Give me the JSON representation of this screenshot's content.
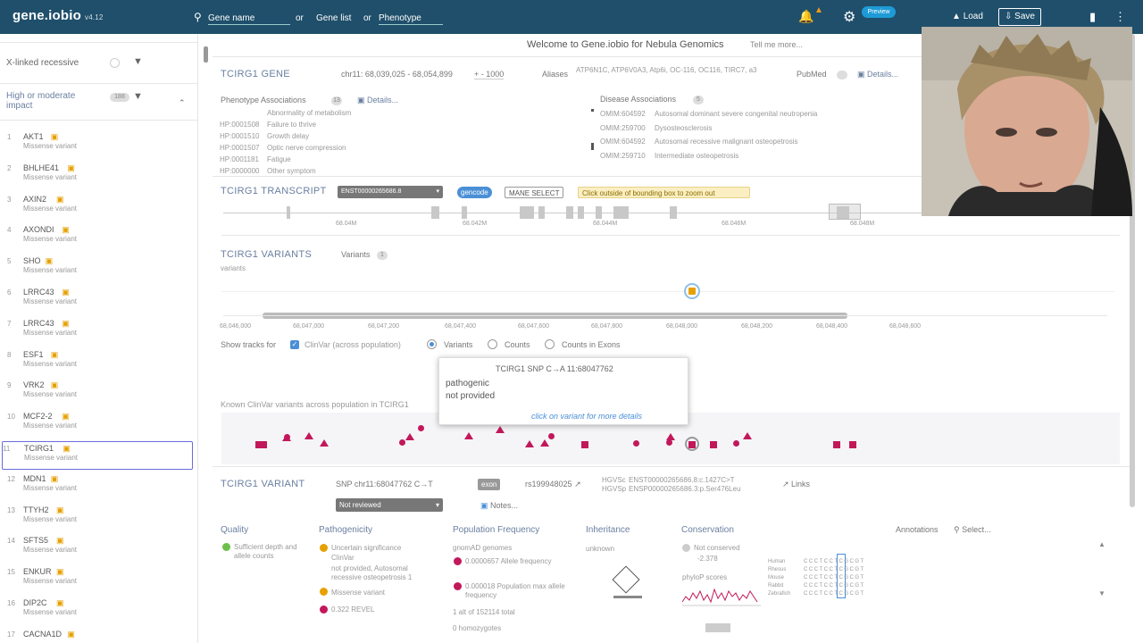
{
  "topbar": {
    "logo": "gene.iobio",
    "version": "v4.12",
    "search": {
      "gene_name": "Gene name",
      "or1": "or",
      "gene_list": "Gene list",
      "or2": "or",
      "phenotype": "Phenotype"
    },
    "pill": "Preview",
    "load": "Load",
    "save": "Save"
  },
  "sidebar": {
    "filter1": "X-linked recessive",
    "filter2_line1": "High or moderate",
    "filter2_line2": "impact",
    "filter2_count": "188",
    "genes": [
      {
        "num": "1",
        "name": "AKT1",
        "type": "Missense variant"
      },
      {
        "num": "2",
        "name": "BHLHE41",
        "type": "Missense variant"
      },
      {
        "num": "3",
        "name": "AXIN2",
        "type": "Missense variant"
      },
      {
        "num": "4",
        "name": "AXONDI",
        "type": "Missense variant"
      },
      {
        "num": "5",
        "name": "SHO",
        "type": "Missense variant"
      },
      {
        "num": "6",
        "name": "LRRC43",
        "type": "Missense variant"
      },
      {
        "num": "7",
        "name": "LRRC43",
        "type": "Missense variant"
      },
      {
        "num": "8",
        "name": "ESF1",
        "type": "Missense variant"
      },
      {
        "num": "9",
        "name": "VRK2",
        "type": "Missense variant"
      },
      {
        "num": "10",
        "name": "MCF2-2",
        "type": "Missense variant"
      },
      {
        "num": "11",
        "name": "TCIRG1",
        "type": "Missense variant"
      },
      {
        "num": "12",
        "name": "MDN1",
        "type": "Missense variant"
      },
      {
        "num": "13",
        "name": "TTYH2",
        "type": "Missense variant"
      },
      {
        "num": "14",
        "name": "SFTS5",
        "type": "Missense variant"
      },
      {
        "num": "15",
        "name": "ENKUR",
        "type": "Missense variant"
      },
      {
        "num": "16",
        "name": "DIP2C",
        "type": "Missense variant"
      },
      {
        "num": "17",
        "name": "CACNA1D",
        "type": ""
      }
    ]
  },
  "welcome": "Welcome to Gene.iobio for Nebula Genomics",
  "tellme": "Tell me more...",
  "gene": {
    "title": "TCIRG1 GENE",
    "coords": "chr11: 68,039,025 - 68,054,899",
    "plusminus": "+ - 1000",
    "aliases_label": "Aliases",
    "aliases": "ATP6N1C, ATP6V0A3, Atp6i, OC-116, OC116, TIRC7, a3",
    "pubmed": "PubMed",
    "details": "Details...",
    "pheno_label": "Phenotype Associations",
    "pheno_count": "13",
    "pheno_details": "Details...",
    "phenotypes": [
      {
        "id": "",
        "name": "Abnormality of metabolism"
      },
      {
        "id": "HP:0001508",
        "name": "Failure to thrive"
      },
      {
        "id": "HP:0001510",
        "name": "Growth delay"
      },
      {
        "id": "HP:0001507",
        "name": "Optic nerve compression"
      },
      {
        "id": "HP:0001181",
        "name": "Fatigue"
      },
      {
        "id": "HP:0000000",
        "name": "Other symptom"
      }
    ],
    "disease_label": "Disease Associations",
    "disease_count": "5",
    "diseases": [
      {
        "id": "OMIM:604592",
        "name": "Autosomal dominant severe congenital neutropenia"
      },
      {
        "id": "OMIM:259700",
        "name": "Dysosteosclerosis"
      },
      {
        "id": "OMIM:604592",
        "name": "Autosomal recessive malignant osteopetrosis"
      },
      {
        "id": "OMIM:259710",
        "name": "Intermediate osteopetrosis"
      }
    ]
  },
  "transcript": {
    "title": "TCIRG1 TRANSCRIPT",
    "select": "ENST00000265686.8",
    "chip_gencode": "gencode",
    "chip_mane": "MANE SELECT",
    "hint": "Click outside of bounding box to zoom out",
    "ticks": [
      "68.04M",
      "68.042M",
      "68.044M",
      "68.046M",
      "68.048M"
    ]
  },
  "variants": {
    "title": "TCIRG1 VARIANTS",
    "sub": "Variants",
    "count": "1",
    "label": "variants",
    "ticks": [
      "68,046,000",
      "68,047,000",
      "68,047,200",
      "68,047,400",
      "68,047,600",
      "68,047,800",
      "68,048,000",
      "68,048,200",
      "68,048,400",
      "68,048,600"
    ],
    "show_tracks": "Show tracks for",
    "clinvar": "ClinVar (across population)",
    "opt_variants": "Variants",
    "opt_counts": "Counts",
    "opt_exons": "Counts in Exons",
    "known": "Known ClinVar variants across population in TCIRG1"
  },
  "tooltip": {
    "title": "TCIRG1 SNP C→A  11:68047762",
    "sig": "pathogenic",
    "sub": "not provided",
    "link": "click on variant for more details"
  },
  "variant": {
    "title": "TCIRG1 VARIANT",
    "snp": "SNP  chr11:68047762  C→T",
    "chip": "exon",
    "rs": "rs199948025",
    "hgvsc_label": "HGVSc",
    "hgvsc": "ENST00000265686.8:c.1427C>T",
    "hgvsp_label": "HGVSp",
    "hgvsp": "ENSP00000265686.3:p.Ser476Leu",
    "links": "Links",
    "reviewed": "Not reviewed",
    "notes": "Notes...",
    "annotations": "Annotations",
    "select": "Select...",
    "cols": {
      "quality": "Quality",
      "pathogenicity": "Pathogenicity",
      "popfreq": "Population Frequency",
      "inheritance": "Inheritance",
      "conservation": "Conservation"
    },
    "quality_text": "Sufficient depth and allele counts",
    "path_lines": [
      "Uncertain significance",
      "ClinVar",
      "not provided, Autosomal",
      "recessive osteopetrosis 1",
      "Missense variant",
      "0.322 REVEL"
    ],
    "pop_lines": [
      "gnomAD genomes",
      "0.0000657 Allele frequency",
      "0.000018 Population max allele frequency",
      "1 alt of 152114 total",
      "0 homozygotes"
    ],
    "inheritance_text": "unknown",
    "cons_text": "Not conserved",
    "cons_val": "-2.378",
    "phylop": "phyloP scores",
    "species": [
      "Human",
      "Rhesus",
      "Mouse",
      "Rabbit",
      "Zebrafish"
    ]
  },
  "colors": {
    "topbar": "#1f4f6b",
    "accent": "#4a8fd6",
    "pathogenic": "#c2185b",
    "star": "#e6a000"
  }
}
